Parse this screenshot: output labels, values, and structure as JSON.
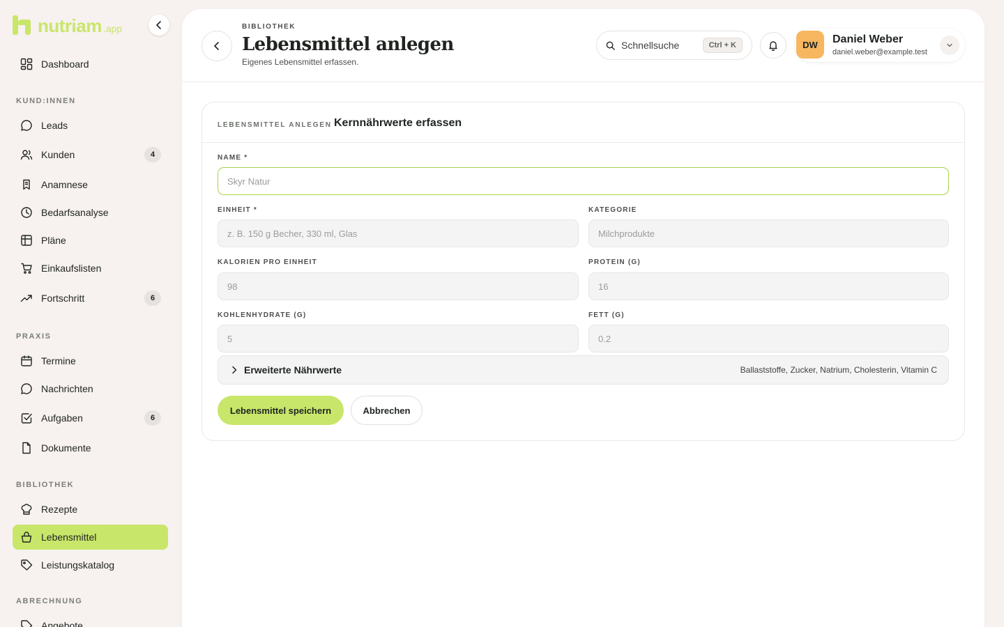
{
  "brand": {
    "name": "nutriam",
    "suffix": ".app",
    "color": "#c8e66a"
  },
  "sidebar": {
    "dashboard": {
      "label": "Dashboard",
      "icon": "dashboard-icon"
    },
    "sections": [
      {
        "title": "KUND:INNEN",
        "items": [
          {
            "label": "Leads",
            "icon": "chat-icon"
          },
          {
            "label": "Kunden",
            "icon": "users-icon",
            "badge": "4"
          },
          {
            "label": "Anamnese",
            "icon": "clipboard-icon"
          },
          {
            "label": "Bedarfsanalyse",
            "icon": "clock-icon"
          },
          {
            "label": "Pläne",
            "icon": "table-icon"
          },
          {
            "label": "Einkaufslisten",
            "icon": "cart-icon"
          },
          {
            "label": "Fortschritt",
            "icon": "trending-icon",
            "badge": "6"
          }
        ]
      },
      {
        "title": "PRAXIS",
        "items": [
          {
            "label": "Termine",
            "icon": "calendar-icon"
          },
          {
            "label": "Nachrichten",
            "icon": "message-icon"
          },
          {
            "label": "Aufgaben",
            "icon": "checkbox-icon",
            "badge": "6"
          },
          {
            "label": "Dokumente",
            "icon": "document-icon"
          }
        ]
      },
      {
        "title": "BIBLIOTHEK",
        "items": [
          {
            "label": "Rezepte",
            "icon": "chef-hat-icon"
          },
          {
            "label": "Lebensmittel",
            "icon": "basket-icon",
            "active": true
          },
          {
            "label": "Leistungskatalog",
            "icon": "tag-icon"
          }
        ]
      },
      {
        "title": "ABRECHNUNG",
        "items": [
          {
            "label": "Angebote",
            "icon": "offer-icon"
          }
        ]
      }
    ]
  },
  "header": {
    "eyebrow": "BIBLIOTHEK",
    "title": "Lebensmittel anlegen",
    "subtitle": "Eigenes Lebensmittel erfassen.",
    "search": {
      "label": "Schnellsuche",
      "shortcut": "Ctrl + K"
    },
    "user": {
      "initials": "DW",
      "name": "Daniel Weber",
      "email": "daniel.weber@example.test"
    }
  },
  "form": {
    "eyebrow": "LEBENSMITTEL ANLEGEN",
    "title": "Kernnährwerte erfassen",
    "fields": {
      "name": {
        "label": "NAME *",
        "value": "",
        "placeholder": "Skyr Natur"
      },
      "unit": {
        "label": "EINHEIT *",
        "value": "",
        "placeholder": "z. B. 150 g Becher, 330 ml, Glas"
      },
      "category": {
        "label": "KATEGORIE",
        "value": "",
        "placeholder": "Milchprodukte"
      },
      "calories": {
        "label": "KALORIEN PRO EINHEIT",
        "value": "",
        "placeholder": "98"
      },
      "protein": {
        "label": "PROTEIN (G)",
        "value": "",
        "placeholder": "16"
      },
      "carbs": {
        "label": "KOHLENHYDRATE (G)",
        "value": "",
        "placeholder": "5"
      },
      "fat": {
        "label": "FETT (G)",
        "value": "",
        "placeholder": "0.2"
      }
    },
    "advanced": {
      "title": "Erweiterte Nährwerte",
      "hint": "Ballaststoffe, Zucker, Natrium, Cholesterin, Vitamin C"
    },
    "save_label": "Lebensmittel speichern",
    "cancel_label": "Abbrechen"
  }
}
